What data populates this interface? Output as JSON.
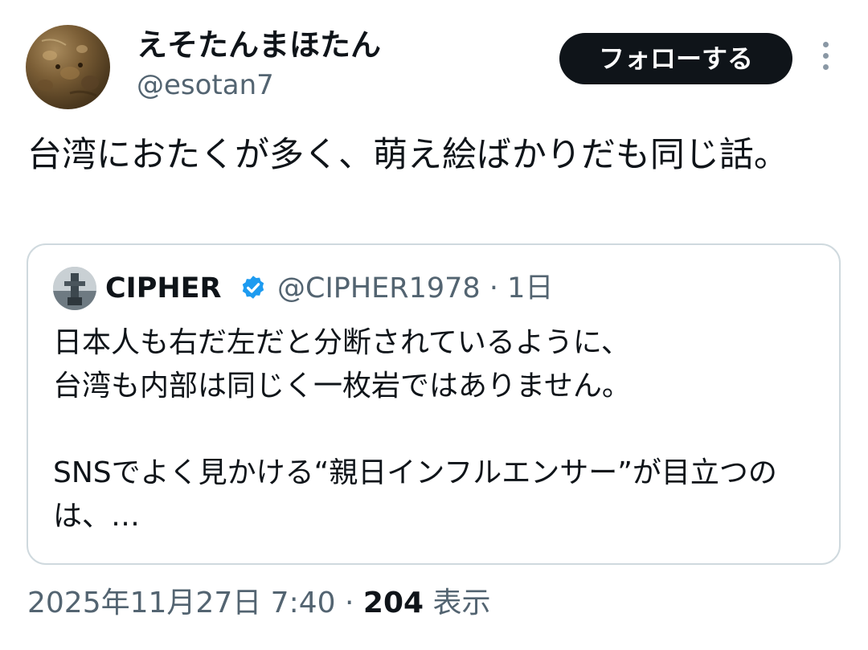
{
  "author": {
    "display_name": "えそたんまほたん",
    "handle": "@esotan7",
    "avatar_icon": "reptile-closeup-avatar"
  },
  "follow_button": {
    "label": "フォローする"
  },
  "more_icon": "more-vertical-icon",
  "tweet": {
    "text": "台湾におたくが多く、萌え絵ばかりだも同じ話。"
  },
  "quote": {
    "author_name": "CIPHER",
    "verified_icon": "verified-badge-icon",
    "verified_color": "#1d9bf0",
    "handle": "@CIPHER1978",
    "separator": "·",
    "age": "1日",
    "text": "日本人も右だ左だと分断されているように、\n台湾も内部は同じく一枚岩ではありません。\n\nSNSでよく見かける“親日インフルエンサー”が目立つのは、…"
  },
  "footer": {
    "timestamp": "2025年11月27日 7:40",
    "separator": "·",
    "views_count": "204",
    "views_label": "表示"
  },
  "colors": {
    "text_primary": "#0f1419",
    "text_secondary": "#536471",
    "border": "#cfd9de",
    "button_bg": "#0f1419"
  }
}
